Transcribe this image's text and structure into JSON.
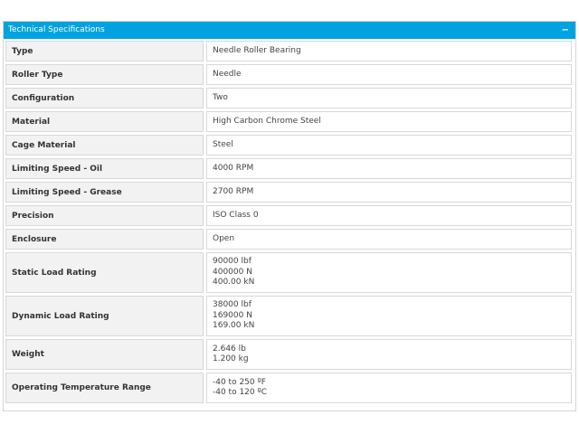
{
  "panel": {
    "title": "Technical Specifications",
    "collapse_symbol": "−"
  },
  "specs": [
    {
      "label": "Type",
      "values": [
        "Needle Roller Bearing"
      ]
    },
    {
      "label": "Roller Type",
      "values": [
        "Needle"
      ]
    },
    {
      "label": "Configuration",
      "values": [
        "Two"
      ]
    },
    {
      "label": "Material",
      "values": [
        "High Carbon Chrome Steel"
      ]
    },
    {
      "label": "Cage Material",
      "values": [
        "Steel"
      ]
    },
    {
      "label": "Limiting Speed - Oil",
      "values": [
        "4000 RPM"
      ]
    },
    {
      "label": "Limiting Speed - Grease",
      "values": [
        "2700 RPM"
      ]
    },
    {
      "label": "Precision",
      "values": [
        "ISO Class 0"
      ]
    },
    {
      "label": "Enclosure",
      "values": [
        "Open"
      ]
    },
    {
      "label": "Static Load Rating",
      "values": [
        "90000 lbf",
        "400000 N",
        "400.00 kN"
      ]
    },
    {
      "label": "Dynamic Load Rating",
      "values": [
        "38000 lbf",
        "169000 N",
        "169.00 kN"
      ]
    },
    {
      "label": "Weight",
      "values": [
        "2.646 lb",
        "1.200 kg"
      ]
    },
    {
      "label": "Operating Temperature Range",
      "values": [
        "-40 to 250 ºF",
        "-40 to 120 ºC"
      ]
    }
  ],
  "colors": {
    "header_bg": "#00a3e0",
    "header_text": "#ffffff",
    "label_bg": "#f2f2f2",
    "border": "#d8d8d8"
  }
}
